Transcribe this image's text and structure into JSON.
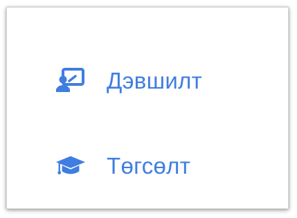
{
  "menu": {
    "items": [
      {
        "icon": "chalkboard-teacher-icon",
        "label": "Дэвшилт"
      },
      {
        "icon": "graduation-cap-icon",
        "label": "Төгсөлт"
      }
    ]
  },
  "colors": {
    "accent": "#3f7ee0",
    "card_border": "#d4d4d4",
    "background": "#ffffff"
  }
}
